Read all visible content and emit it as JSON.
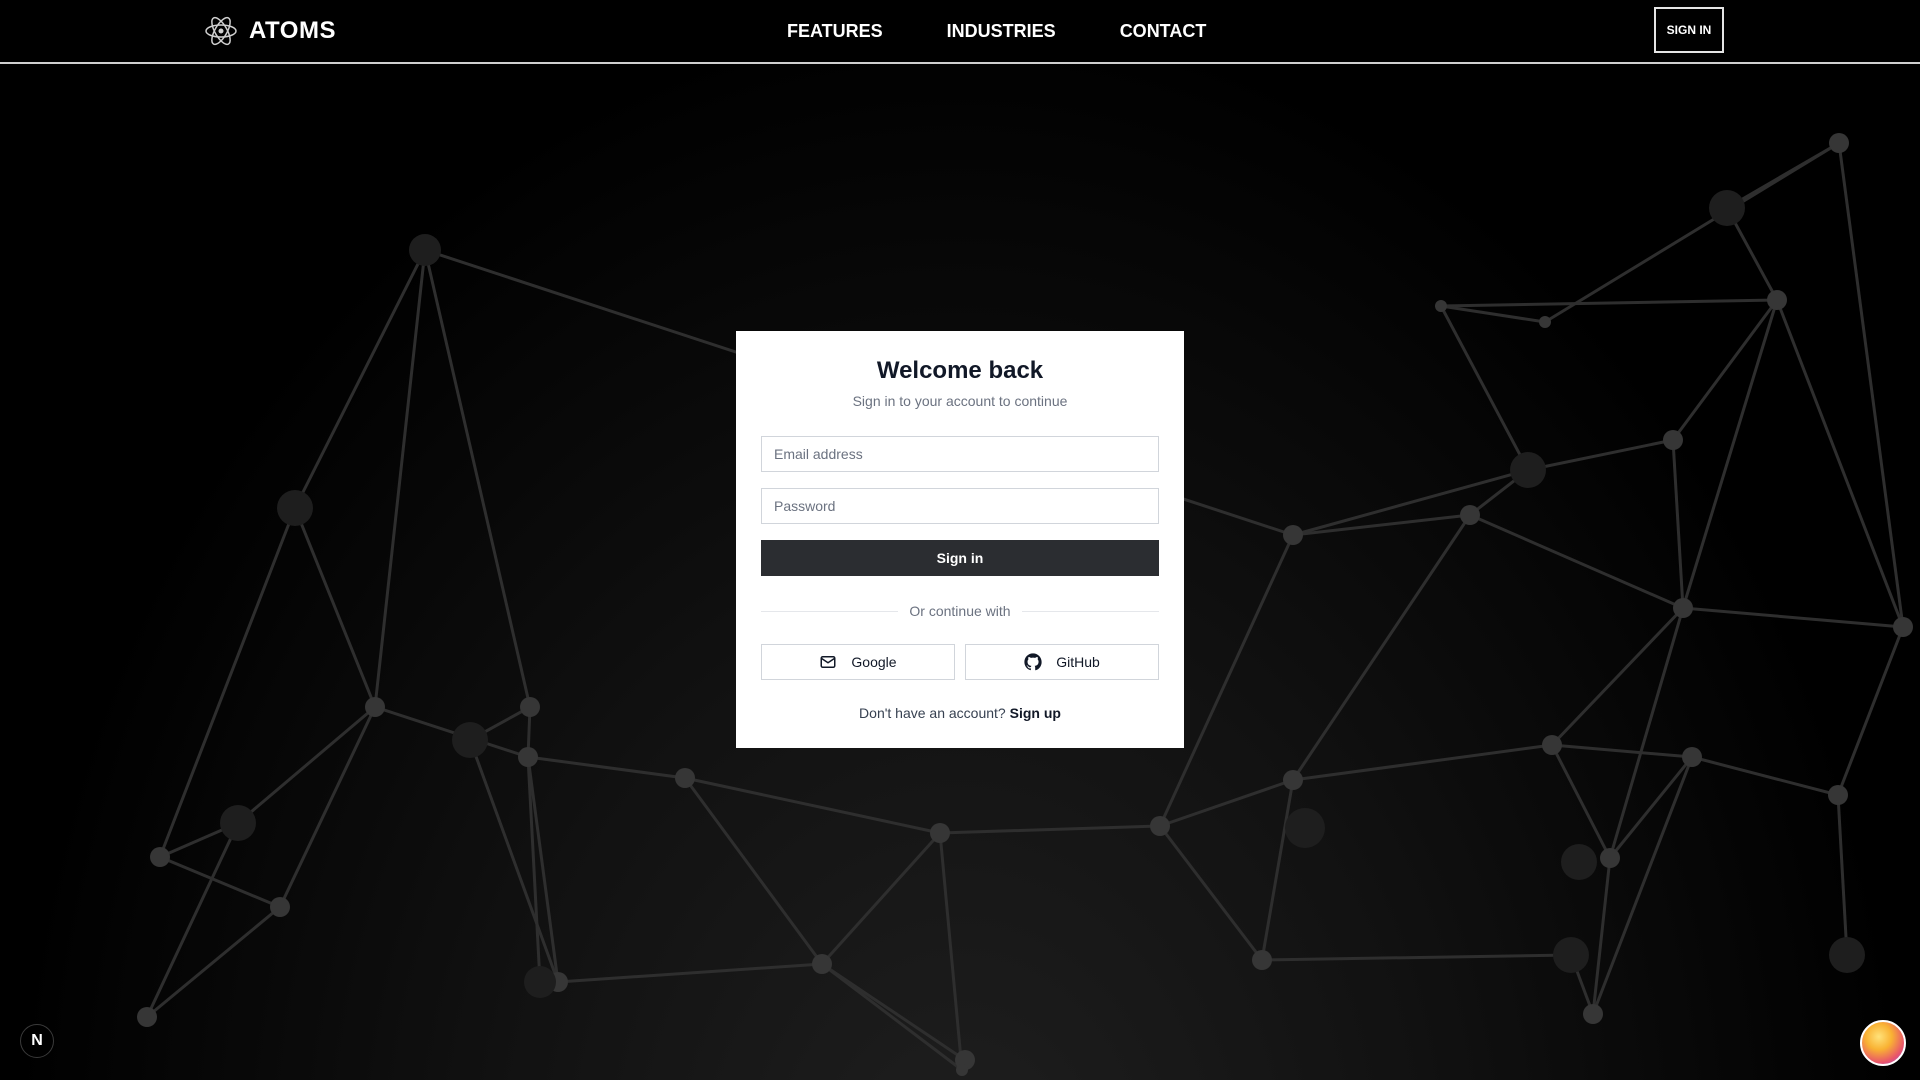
{
  "navbar": {
    "brand": "ATOMS",
    "links": [
      "FEATURES",
      "INDUSTRIES",
      "CONTACT"
    ],
    "signin_label": "SIGN IN"
  },
  "login": {
    "title": "Welcome back",
    "subtitle": "Sign in to your account to continue",
    "email_placeholder": "Email address",
    "email_value": "",
    "password_placeholder": "Password",
    "password_value": "",
    "submit_label": "Sign in",
    "divider_text": "Or continue with",
    "google_label": "Google",
    "github_label": "GitHub",
    "signup_prompt": "Don't have an account?",
    "signup_link": "Sign up"
  },
  "badges": {
    "next_letter": "N"
  },
  "colors": {
    "background": "#000000",
    "card": "#ffffff",
    "primary_button": "#2b2d31",
    "network_lines": "#2e2e2e",
    "network_nodes": "#3a3a3a"
  },
  "icons": {
    "brand": "atom-icon",
    "google": "mail-icon",
    "github": "github-icon",
    "next": "nextjs-icon",
    "assistant": "assistant-icon"
  }
}
